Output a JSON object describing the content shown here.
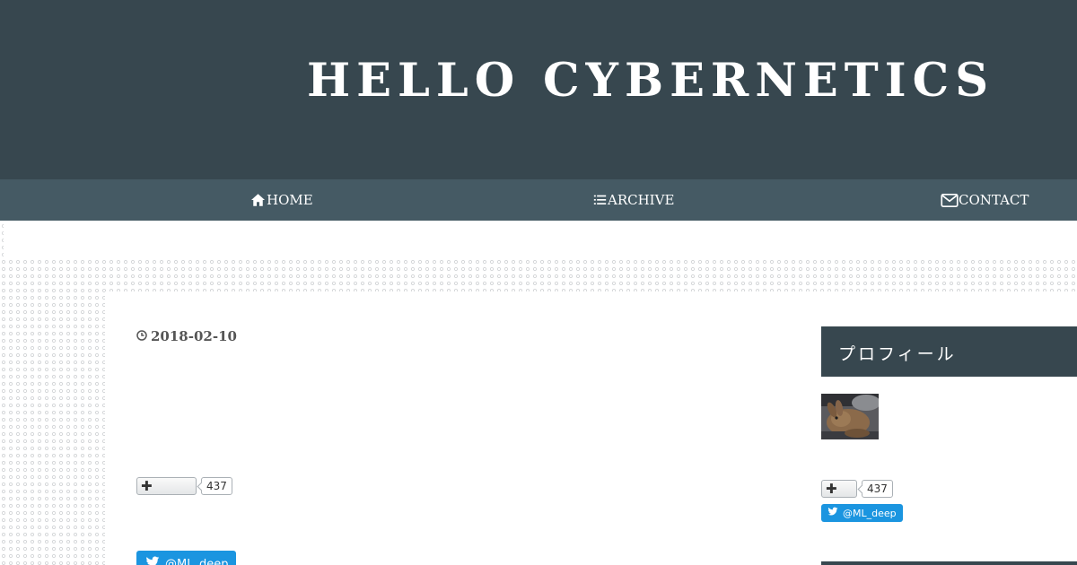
{
  "header": {
    "site_title": "HELLO CYBERNETICS"
  },
  "nav": {
    "items": [
      {
        "label": "HOME",
        "icon": "home-icon"
      },
      {
        "label": "ARCHIVE",
        "icon": "list-icon"
      },
      {
        "label": "CONTACT",
        "icon": "mail-icon"
      }
    ]
  },
  "article": {
    "date": "2018-02-10",
    "date_icon": "clock-icon",
    "bookmark": {
      "icon": "plus-icon",
      "count": "437"
    },
    "twitter": {
      "label": "@ML_deep",
      "icon": "twitter-bird-icon"
    }
  },
  "sidebar": {
    "section_title": "プロフィール",
    "avatar": "rabbit-avatar",
    "bookmark": {
      "icon": "plus-icon",
      "count": "437"
    },
    "twitter": {
      "label": "@ML_deep",
      "icon": "twitter-bird-icon"
    }
  },
  "colors": {
    "header_bg": "#37474f",
    "nav_bg": "#455a64",
    "twitter_blue": "#1b95e0"
  }
}
